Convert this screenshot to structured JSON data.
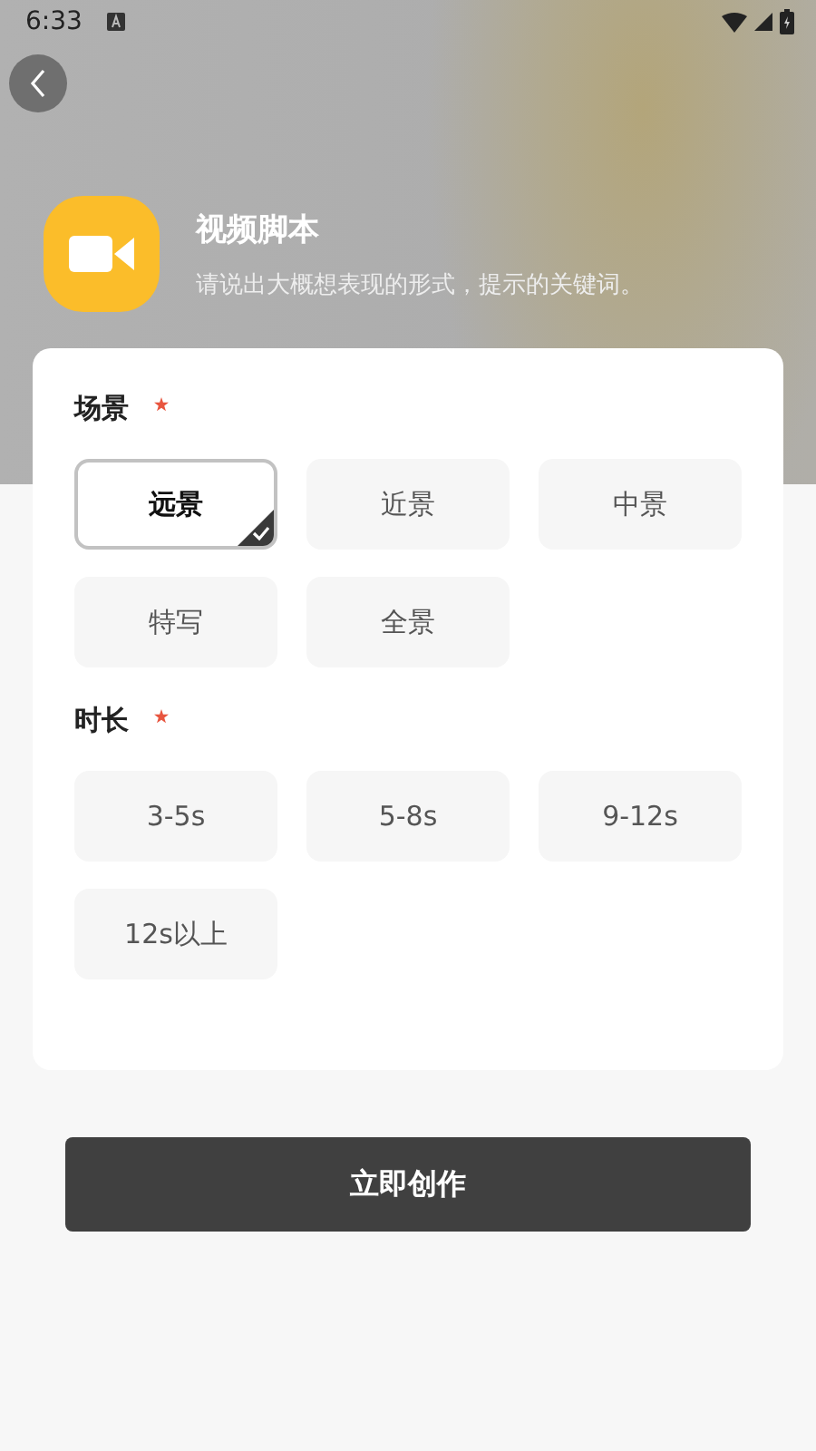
{
  "status_bar": {
    "time": "6:33"
  },
  "header": {
    "title": "视频脚本",
    "subtitle": "请说出大概想表现的形式，提示的关键词。"
  },
  "sections": [
    {
      "label": "场景",
      "required": true,
      "options": [
        {
          "label": "远景",
          "selected": true
        },
        {
          "label": "近景",
          "selected": false
        },
        {
          "label": "中景",
          "selected": false
        },
        {
          "label": "特写",
          "selected": false
        },
        {
          "label": "全景",
          "selected": false
        }
      ]
    },
    {
      "label": "时长",
      "required": true,
      "options": [
        {
          "label": "3-5s",
          "selected": false
        },
        {
          "label": "5-8s",
          "selected": false
        },
        {
          "label": "9-12s",
          "selected": false
        },
        {
          "label": "12s以上",
          "selected": false
        }
      ]
    }
  ],
  "submit_button": {
    "label": "立即创作"
  }
}
